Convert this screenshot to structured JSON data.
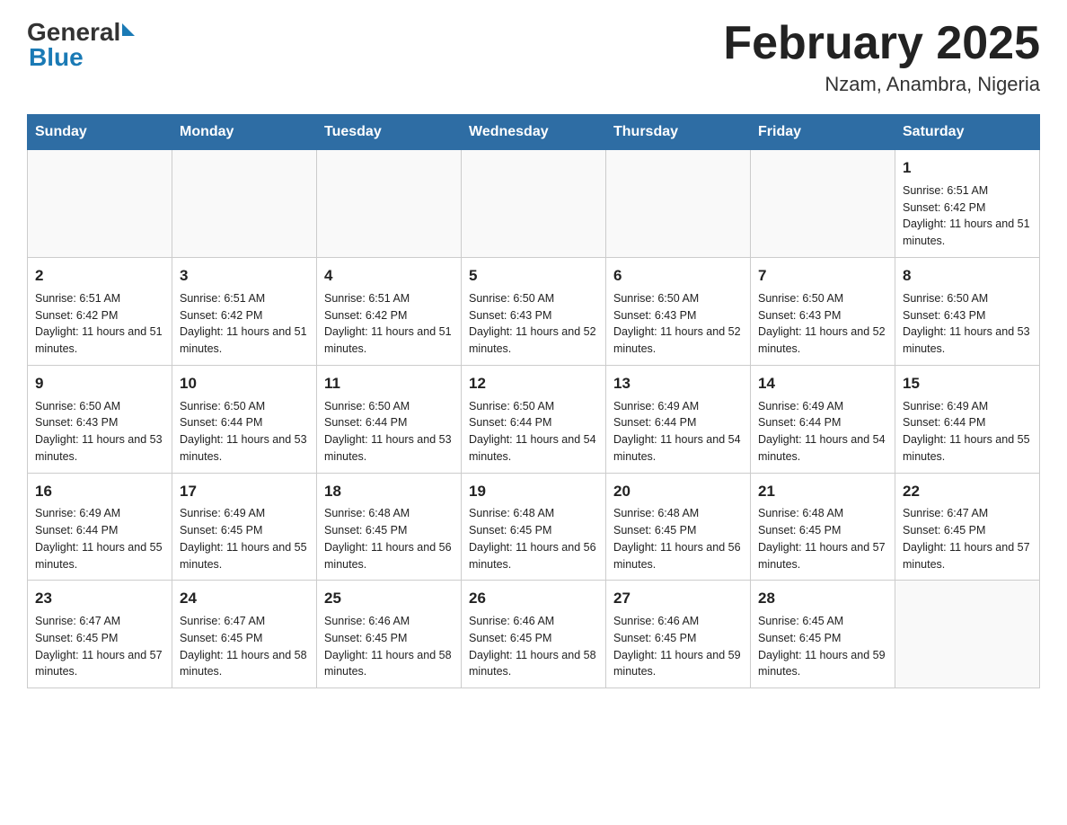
{
  "header": {
    "logo_general": "General",
    "logo_blue": "Blue",
    "month_title": "February 2025",
    "location": "Nzam, Anambra, Nigeria"
  },
  "weekdays": [
    "Sunday",
    "Monday",
    "Tuesday",
    "Wednesday",
    "Thursday",
    "Friday",
    "Saturday"
  ],
  "weeks": [
    [
      {
        "day": "",
        "info": ""
      },
      {
        "day": "",
        "info": ""
      },
      {
        "day": "",
        "info": ""
      },
      {
        "day": "",
        "info": ""
      },
      {
        "day": "",
        "info": ""
      },
      {
        "day": "",
        "info": ""
      },
      {
        "day": "1",
        "info": "Sunrise: 6:51 AM\nSunset: 6:42 PM\nDaylight: 11 hours and 51 minutes."
      }
    ],
    [
      {
        "day": "2",
        "info": "Sunrise: 6:51 AM\nSunset: 6:42 PM\nDaylight: 11 hours and 51 minutes."
      },
      {
        "day": "3",
        "info": "Sunrise: 6:51 AM\nSunset: 6:42 PM\nDaylight: 11 hours and 51 minutes."
      },
      {
        "day": "4",
        "info": "Sunrise: 6:51 AM\nSunset: 6:42 PM\nDaylight: 11 hours and 51 minutes."
      },
      {
        "day": "5",
        "info": "Sunrise: 6:50 AM\nSunset: 6:43 PM\nDaylight: 11 hours and 52 minutes."
      },
      {
        "day": "6",
        "info": "Sunrise: 6:50 AM\nSunset: 6:43 PM\nDaylight: 11 hours and 52 minutes."
      },
      {
        "day": "7",
        "info": "Sunrise: 6:50 AM\nSunset: 6:43 PM\nDaylight: 11 hours and 52 minutes."
      },
      {
        "day": "8",
        "info": "Sunrise: 6:50 AM\nSunset: 6:43 PM\nDaylight: 11 hours and 53 minutes."
      }
    ],
    [
      {
        "day": "9",
        "info": "Sunrise: 6:50 AM\nSunset: 6:43 PM\nDaylight: 11 hours and 53 minutes."
      },
      {
        "day": "10",
        "info": "Sunrise: 6:50 AM\nSunset: 6:44 PM\nDaylight: 11 hours and 53 minutes."
      },
      {
        "day": "11",
        "info": "Sunrise: 6:50 AM\nSunset: 6:44 PM\nDaylight: 11 hours and 53 minutes."
      },
      {
        "day": "12",
        "info": "Sunrise: 6:50 AM\nSunset: 6:44 PM\nDaylight: 11 hours and 54 minutes."
      },
      {
        "day": "13",
        "info": "Sunrise: 6:49 AM\nSunset: 6:44 PM\nDaylight: 11 hours and 54 minutes."
      },
      {
        "day": "14",
        "info": "Sunrise: 6:49 AM\nSunset: 6:44 PM\nDaylight: 11 hours and 54 minutes."
      },
      {
        "day": "15",
        "info": "Sunrise: 6:49 AM\nSunset: 6:44 PM\nDaylight: 11 hours and 55 minutes."
      }
    ],
    [
      {
        "day": "16",
        "info": "Sunrise: 6:49 AM\nSunset: 6:44 PM\nDaylight: 11 hours and 55 minutes."
      },
      {
        "day": "17",
        "info": "Sunrise: 6:49 AM\nSunset: 6:45 PM\nDaylight: 11 hours and 55 minutes."
      },
      {
        "day": "18",
        "info": "Sunrise: 6:48 AM\nSunset: 6:45 PM\nDaylight: 11 hours and 56 minutes."
      },
      {
        "day": "19",
        "info": "Sunrise: 6:48 AM\nSunset: 6:45 PM\nDaylight: 11 hours and 56 minutes."
      },
      {
        "day": "20",
        "info": "Sunrise: 6:48 AM\nSunset: 6:45 PM\nDaylight: 11 hours and 56 minutes."
      },
      {
        "day": "21",
        "info": "Sunrise: 6:48 AM\nSunset: 6:45 PM\nDaylight: 11 hours and 57 minutes."
      },
      {
        "day": "22",
        "info": "Sunrise: 6:47 AM\nSunset: 6:45 PM\nDaylight: 11 hours and 57 minutes."
      }
    ],
    [
      {
        "day": "23",
        "info": "Sunrise: 6:47 AM\nSunset: 6:45 PM\nDaylight: 11 hours and 57 minutes."
      },
      {
        "day": "24",
        "info": "Sunrise: 6:47 AM\nSunset: 6:45 PM\nDaylight: 11 hours and 58 minutes."
      },
      {
        "day": "25",
        "info": "Sunrise: 6:46 AM\nSunset: 6:45 PM\nDaylight: 11 hours and 58 minutes."
      },
      {
        "day": "26",
        "info": "Sunrise: 6:46 AM\nSunset: 6:45 PM\nDaylight: 11 hours and 58 minutes."
      },
      {
        "day": "27",
        "info": "Sunrise: 6:46 AM\nSunset: 6:45 PM\nDaylight: 11 hours and 59 minutes."
      },
      {
        "day": "28",
        "info": "Sunrise: 6:45 AM\nSunset: 6:45 PM\nDaylight: 11 hours and 59 minutes."
      },
      {
        "day": "",
        "info": ""
      }
    ]
  ]
}
